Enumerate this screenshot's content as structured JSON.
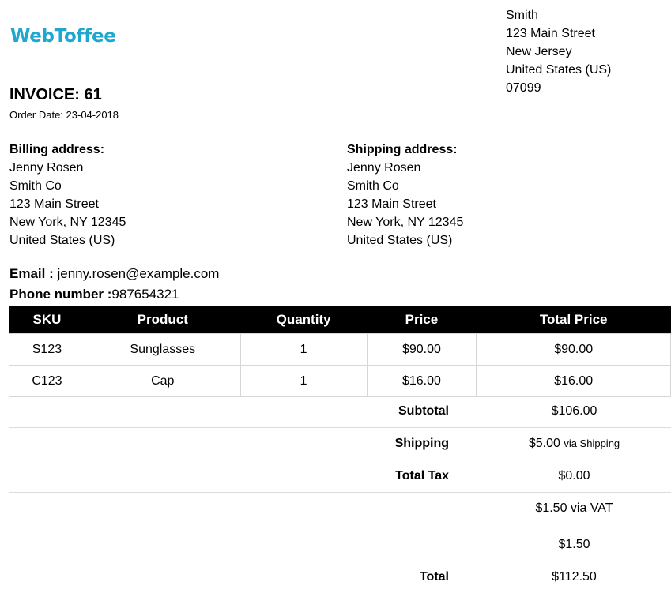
{
  "logo_text": "WebToffee",
  "from_address": [
    "Smith",
    "123 Main Street",
    "New Jersey",
    "United States (US)",
    "07099"
  ],
  "invoice_title": "INVOICE: 61",
  "order_date": "Order Date: 23-04-2018",
  "billing": {
    "heading": "Billing address:",
    "lines": [
      "Jenny Rosen",
      "Smith Co",
      "123 Main Street",
      "New York, NY 12345",
      "United States (US)"
    ]
  },
  "shipping": {
    "heading": "Shipping address:",
    "lines": [
      "Jenny Rosen",
      "Smith Co",
      "123 Main Street",
      "New York, NY 12345",
      "United States (US)"
    ]
  },
  "email": {
    "label": "Email :",
    "value": "jenny.rosen@example.com"
  },
  "phone": {
    "label": "Phone number :",
    "value": "987654321"
  },
  "table": {
    "headers": [
      "SKU",
      "Product",
      "Quantity",
      "Price",
      "Total Price"
    ],
    "rows": [
      [
        "S123",
        "Sunglasses",
        "1",
        "$90.00",
        "$90.00"
      ],
      [
        "C123",
        "Cap",
        "1",
        "$16.00",
        "$16.00"
      ]
    ]
  },
  "totals": {
    "subtotal_label": "Subtotal",
    "subtotal_value": "$106.00",
    "shipping_label": "Shipping",
    "shipping_value": "$5.00",
    "shipping_via": "via Shipping",
    "tax_label": "Total Tax",
    "tax_value": "$0.00",
    "vat_line": "$1.50 via VAT",
    "vat_amount": "$1.50",
    "total_label": "Total",
    "total_value": "$112.50"
  }
}
